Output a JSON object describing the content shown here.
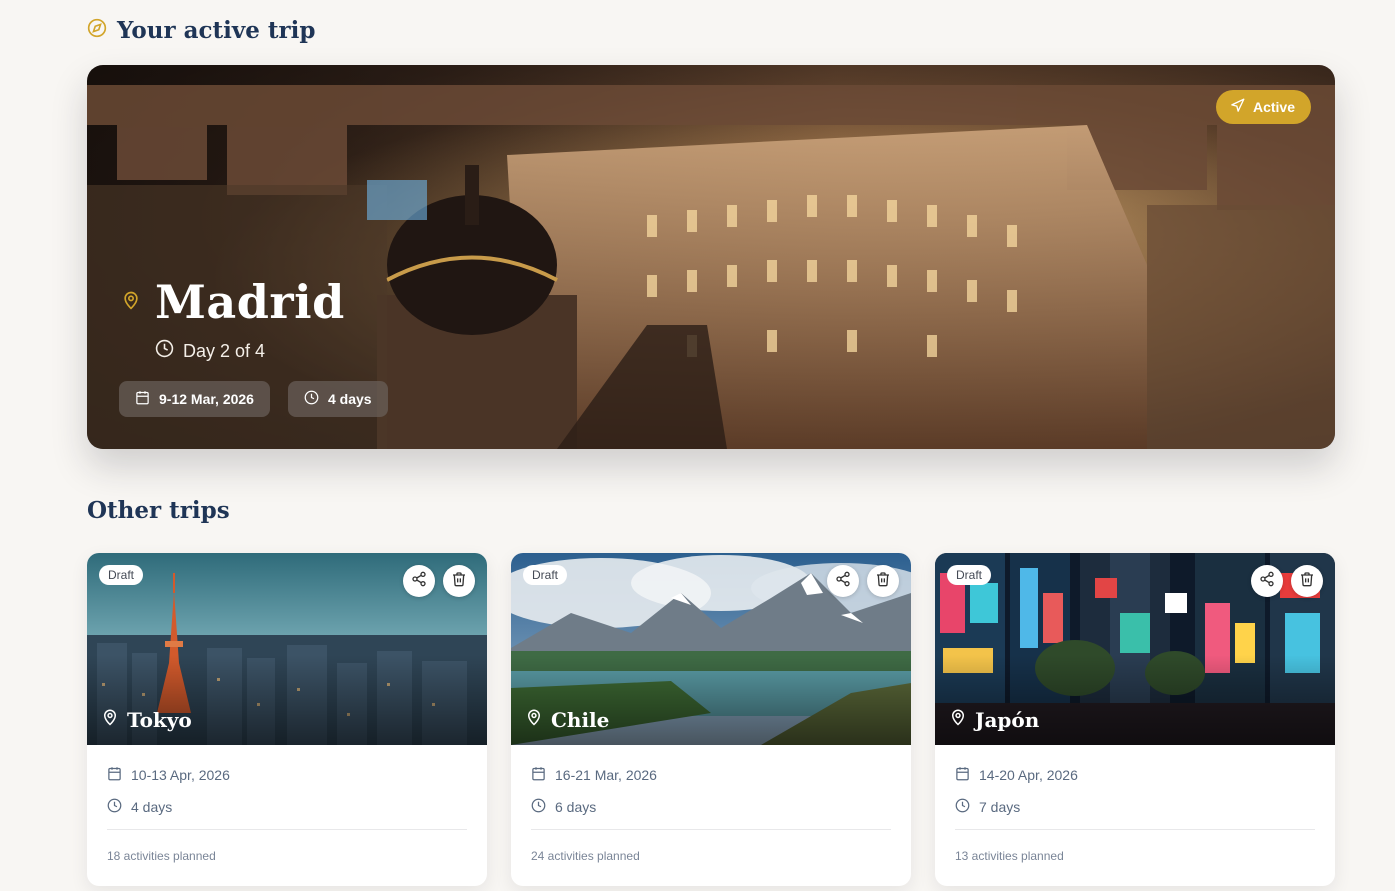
{
  "active_section": {
    "title": "Your active trip",
    "icon": "compass-icon",
    "trip": {
      "status": "Active",
      "city": "Madrid",
      "progress": "Day 2 of 4",
      "dates": "9-12 Mar, 2026",
      "duration": "4 days"
    }
  },
  "other_section": {
    "title": "Other trips",
    "trips": [
      {
        "status": "Draft",
        "city": "Tokyo",
        "dates": "10-13 Apr, 2026",
        "duration": "4 days",
        "activities": "18 activities planned"
      },
      {
        "status": "Draft",
        "city": "Chile",
        "dates": "16-21 Mar, 2026",
        "duration": "6 days",
        "activities": "24 activities planned"
      },
      {
        "status": "Draft",
        "city": "Japón",
        "dates": "14-20 Apr, 2026",
        "duration": "7 days",
        "activities": "13 activities planned"
      }
    ]
  },
  "colors": {
    "background": "#f8f6f3",
    "heading": "#1f3556",
    "accent_gold": "#d2a52a",
    "muted_text": "#5a6a80"
  }
}
